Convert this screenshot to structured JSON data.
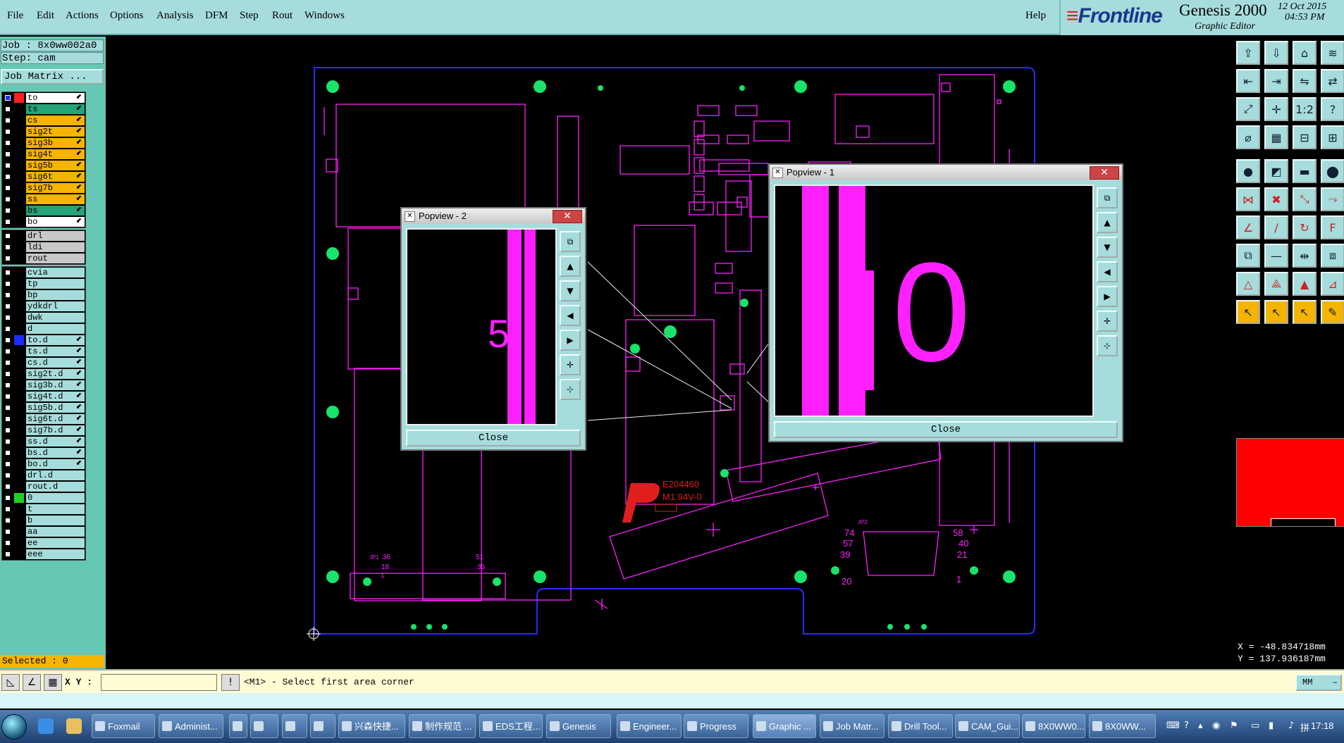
{
  "menu": [
    "File",
    "Edit",
    "Actions",
    "Options",
    "Analysis",
    "DFM",
    "Step",
    "Rout",
    "Windows"
  ],
  "help": "Help",
  "brand": {
    "logo": "Frontline",
    "product": "Genesis 2000",
    "subtitle": "Graphic Editor",
    "date": "12 Oct 2015",
    "time": "04:53 PM"
  },
  "job": {
    "job_line": "Job : 8x0ww002a0",
    "step_line": "Step: cam",
    "matrix_button": "Job Matrix ..."
  },
  "layer_groups": [
    [
      {
        "name": "to",
        "color": "#ffffff",
        "swatch": "#ff2020",
        "active": true
      },
      {
        "name": "ts",
        "color": "#26a37a",
        "swatch": ""
      },
      {
        "name": "cs",
        "color": "#f5b400",
        "swatch": ""
      },
      {
        "name": "sig2t",
        "color": "#f5b400",
        "swatch": ""
      },
      {
        "name": "sig3b",
        "color": "#f5b400",
        "swatch": ""
      },
      {
        "name": "sig4t",
        "color": "#f5b400",
        "swatch": ""
      },
      {
        "name": "sig5b",
        "color": "#f5b400",
        "swatch": ""
      },
      {
        "name": "sig6t",
        "color": "#f5b400",
        "swatch": ""
      },
      {
        "name": "sig7b",
        "color": "#f5b400",
        "swatch": ""
      },
      {
        "name": "ss",
        "color": "#f5b400",
        "swatch": ""
      },
      {
        "name": "bs",
        "color": "#26a37a",
        "swatch": ""
      },
      {
        "name": "bo",
        "color": "#ffffff",
        "swatch": ""
      }
    ],
    [
      {
        "name": "drl",
        "color": "#c8c8c8",
        "swatch": ""
      },
      {
        "name": "ldi",
        "color": "#c8c8c8",
        "swatch": ""
      },
      {
        "name": "rout",
        "color": "#c8c8c8",
        "swatch": ""
      }
    ],
    [
      {
        "name": "cvia",
        "color": "#a6dcdc",
        "swatch": ""
      },
      {
        "name": "tp",
        "color": "#a6dcdc",
        "swatch": ""
      },
      {
        "name": "bp",
        "color": "#a6dcdc",
        "swatch": ""
      },
      {
        "name": "ydkdrl",
        "color": "#a6dcdc",
        "swatch": ""
      },
      {
        "name": "dwk",
        "color": "#a6dcdc",
        "swatch": ""
      },
      {
        "name": "d",
        "color": "#a6dcdc",
        "swatch": ""
      },
      {
        "name": "to.d",
        "color": "#a6dcdc",
        "swatch": "#1a2cff"
      },
      {
        "name": "ts.d",
        "color": "#a6dcdc",
        "swatch": ""
      },
      {
        "name": "cs.d",
        "color": "#a6dcdc",
        "swatch": ""
      },
      {
        "name": "sig2t.d",
        "color": "#a6dcdc",
        "swatch": ""
      },
      {
        "name": "sig3b.d",
        "color": "#a6dcdc",
        "swatch": ""
      },
      {
        "name": "sig4t.d",
        "color": "#a6dcdc",
        "swatch": ""
      },
      {
        "name": "sig5b.d",
        "color": "#a6dcdc",
        "swatch": ""
      },
      {
        "name": "sig6t.d",
        "color": "#a6dcdc",
        "swatch": ""
      },
      {
        "name": "sig7b.d",
        "color": "#a6dcdc",
        "swatch": ""
      },
      {
        "name": "ss.d",
        "color": "#a6dcdc",
        "swatch": ""
      },
      {
        "name": "bs.d",
        "color": "#a6dcdc",
        "swatch": ""
      },
      {
        "name": "bo.d",
        "color": "#a6dcdc",
        "swatch": ""
      },
      {
        "name": "drl.d",
        "color": "#a6dcdc",
        "swatch": ""
      },
      {
        "name": "rout.d",
        "color": "#a6dcdc",
        "swatch": ""
      },
      {
        "name": "0",
        "color": "#a6dcdc",
        "swatch": "#20d020"
      },
      {
        "name": "t",
        "color": "#a6dcdc",
        "swatch": ""
      },
      {
        "name": "b",
        "color": "#a6dcdc",
        "swatch": ""
      },
      {
        "name": "aa",
        "color": "#a6dcdc",
        "swatch": ""
      },
      {
        "name": "ee",
        "color": "#a6dcdc",
        "swatch": ""
      },
      {
        "name": "eee",
        "color": "#a6dcdc",
        "swatch": ""
      }
    ]
  ],
  "selected": "Selected : 0",
  "popview1": {
    "title": "Popview - 1",
    "close": "Close",
    "glyph": "0"
  },
  "popview2": {
    "title": "Popview - 2",
    "close": "Close",
    "glyph": "5"
  },
  "board_text": {
    "ul_mark": "E204460",
    "ul_rating": "M1 94V-0",
    "pads_right": [
      "74",
      "57",
      "39"
    ],
    "pads_right2": [
      "58",
      "40",
      "21"
    ],
    "pad_20": "20",
    "pad_1": "1",
    "jp1_36": "36",
    "jp1_18": "18",
    "jp1_1": "1",
    "jp1_51": "51",
    "jp1_35": "35",
    "jp1_label": "JP1",
    "jp2_label": "JP2"
  },
  "coords": {
    "x": "X = -48.834718mm",
    "y": "Y = 137.936187mm"
  },
  "command": {
    "xy_label": "X Y :",
    "message": "<M1> - Select first area corner",
    "units": "MM"
  },
  "taskbar": {
    "tasks": [
      "Foxmail",
      "Administ...",
      "",
      "",
      "",
      "",
      "兴森快捷...",
      "制作规范 ...",
      "EDS工程...",
      "Genesis",
      "Engineer...",
      "Progress",
      "Graphic ...",
      "Job Matr...",
      "Drill Tool...",
      "CAM_Gui...",
      "8X0WW0...",
      "8X0WW..."
    ],
    "clock": "17:18"
  },
  "colors": {
    "outline": "#ff20ff",
    "board_edge": "#2a2aff",
    "pad": "#19e36a",
    "panel": "#a6dcdc",
    "accent": "#66c8b4"
  }
}
